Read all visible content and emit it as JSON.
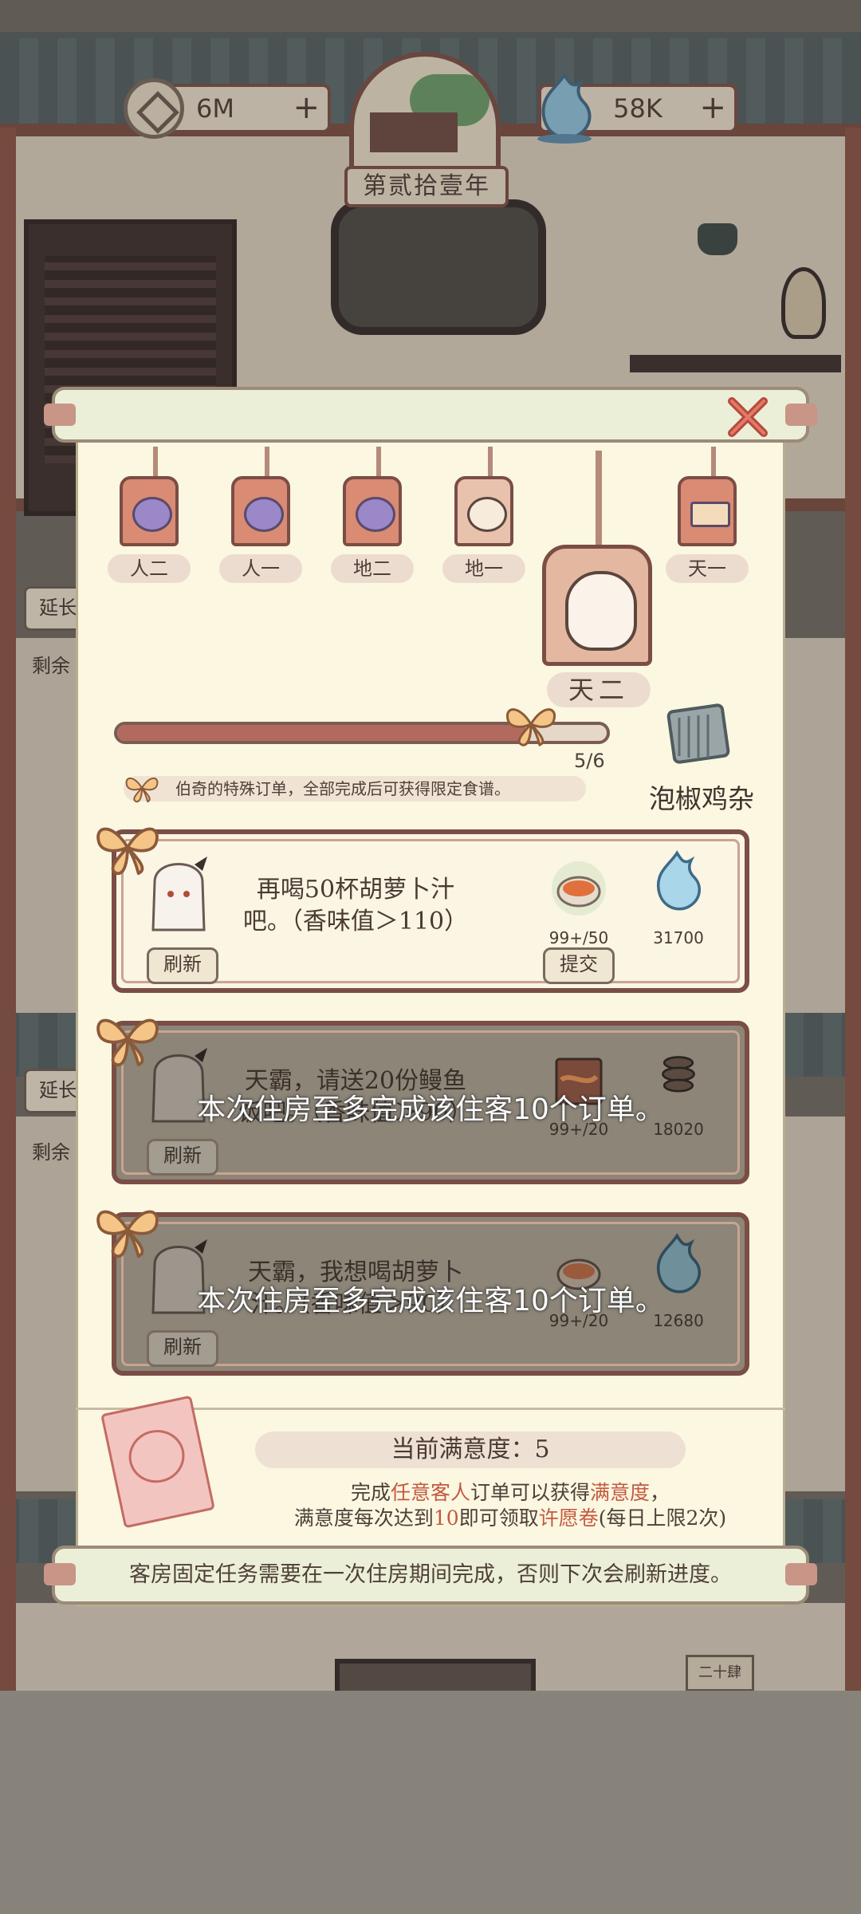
{
  "hud": {
    "coins": "6M",
    "spirit": "58K",
    "plus": "+",
    "year": "第贰拾壹年"
  },
  "background": {
    "extend_label": "延长",
    "remaining_label": "剩余",
    "room_tag": "二十肆"
  },
  "ranks": [
    {
      "label": "人二",
      "icon": "purple-orb"
    },
    {
      "label": "人一",
      "icon": "purple-orb"
    },
    {
      "label": "地二",
      "icon": "purple-orb"
    },
    {
      "label": "地一",
      "icon": "guest-face"
    },
    {
      "label": "天一",
      "icon": "blank-plaque"
    }
  ],
  "current_rank": {
    "label": "天二",
    "icon": "guest-face"
  },
  "progress": {
    "text": "5/6",
    "current": 5,
    "total": 6,
    "note": "伯奇的特殊订单，全部完成后可获得限定食谱。",
    "reward_name": "泡椒鸡杂"
  },
  "orders": [
    {
      "text": "再喝50杯胡萝卜汁吧。（香味值＞110）",
      "refresh": "刷新",
      "submit": "提交",
      "item1_count": "99+/50",
      "item2_count": "31700",
      "locked": false
    },
    {
      "text": "天霸，请送20份鳗鱼饭吧。（香味值＞90）",
      "refresh": "刷新",
      "item1_count": "99+/20",
      "item2_count": "18020",
      "locked": true,
      "lock_message": "本次住房至多完成该住客10个订单。"
    },
    {
      "text": "天霸，我想喝胡萝卜汁。（香味值＞90）",
      "refresh": "刷新",
      "item1_count": "99+/20",
      "item2_count": "12680",
      "locked": true,
      "lock_message": "本次住房至多完成该住客10个订单。"
    }
  ],
  "satisfaction": {
    "title": "当前满意度：5",
    "line1_a": "完成",
    "line1_b": "任意客人",
    "line1_c": "订单可以获得",
    "line1_d": "满意度",
    "line1_e": "，",
    "line2_a": "满意度每次达到",
    "line2_b": "10",
    "line2_c": "即可领取",
    "line2_d": "许愿卷",
    "line2_e": "(每日上限2次)"
  },
  "footer_note": "客房固定任务需要在一次住房期间完成，否则下次会刷新进度。",
  "colors": {
    "accent": "#c4593f",
    "frame": "#7a4d45",
    "paper": "#fbf7e1"
  }
}
